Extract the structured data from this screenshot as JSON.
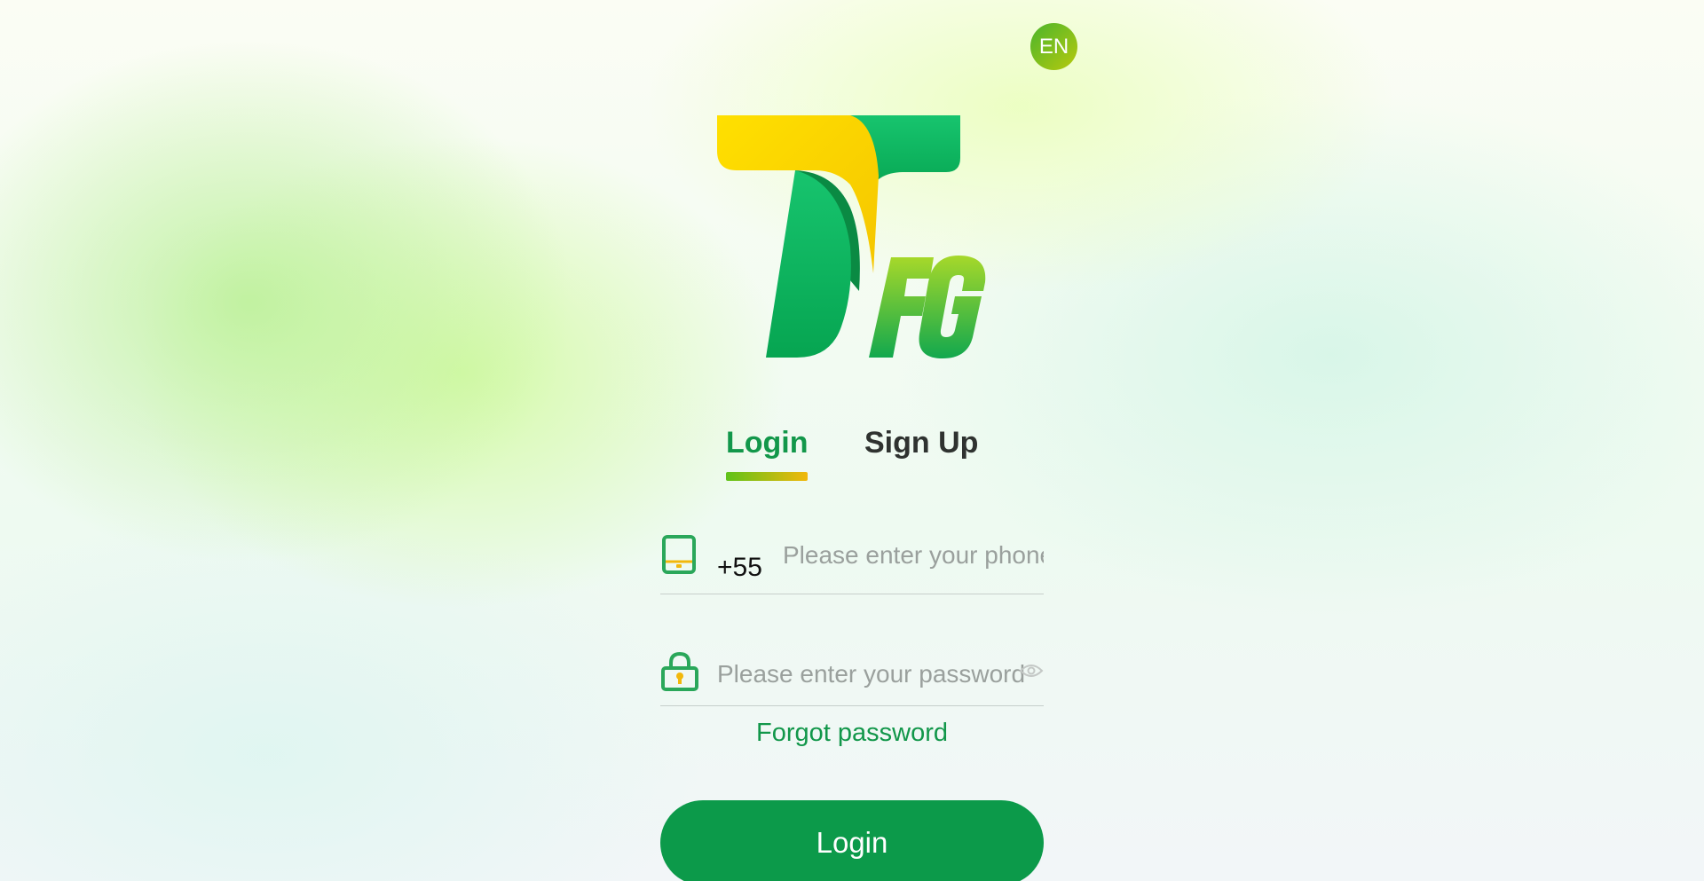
{
  "language_switch": {
    "label": "EN"
  },
  "brand": {
    "logo_text": "TFG"
  },
  "tabs": [
    {
      "label": "Login",
      "active": true
    },
    {
      "label": "Sign Up",
      "active": false
    }
  ],
  "phone_field": {
    "icon": "phone-icon",
    "country_code": "+55",
    "placeholder": "Please enter your phone number",
    "value": ""
  },
  "password_field": {
    "icon": "lock-icon",
    "placeholder": "Please enter your password",
    "value": "",
    "toggle_icon": "eye-icon"
  },
  "forgot_password": {
    "label": "Forgot password"
  },
  "login_button": {
    "label": "Login"
  },
  "colors": {
    "primary_green": "#0c9a4a",
    "tab_active": "#12974a",
    "accent_yellow": "#f2b80c"
  }
}
